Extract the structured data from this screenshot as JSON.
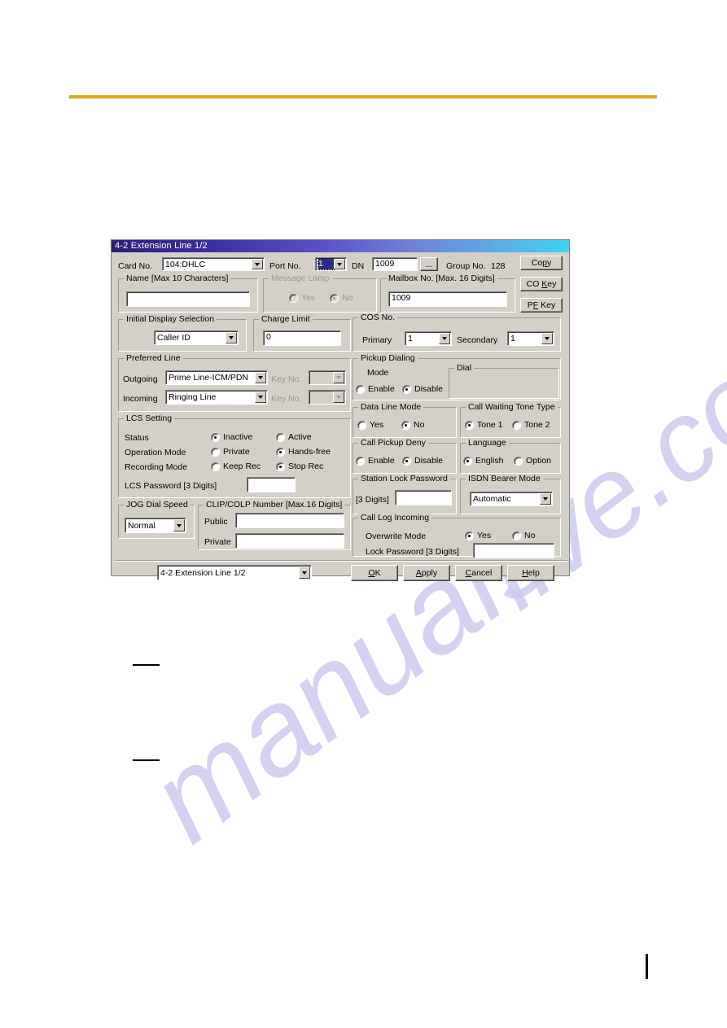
{
  "page": {
    "watermark_left": "manuals",
    "watermark_right": "live.com"
  },
  "dialog": {
    "title": "4-2 Extension Line 1/2",
    "header": {
      "card_no_label": "Card No.",
      "card_no_value": "104:DHLC",
      "port_no_label": "Port No.",
      "port_no_value": "1",
      "dn_label": "DN",
      "dn_value": "1009",
      "dn_browse_label": "...",
      "group_no_label": "Group No.",
      "group_no_value": "128"
    },
    "side_buttons": [
      {
        "name": "copy-button",
        "pre": "Co",
        "key": "p",
        "post": "y"
      },
      {
        "name": "co-key-button",
        "pre": "CO ",
        "key": "K",
        "post": "ey"
      },
      {
        "name": "pf-key-button",
        "pre": "P",
        "key": "F",
        "post": " Key"
      }
    ],
    "name_group": {
      "legend": "Name [Max 10 Characters]",
      "value": ""
    },
    "message_lamp_group": {
      "legend": "Message Lamp",
      "options": [
        "Yes",
        "No"
      ],
      "selected": "No",
      "disabled": true
    },
    "mailbox_group": {
      "legend": "Mailbox No. [Max. 16 Digits]",
      "value": "1009"
    },
    "initial_display_group": {
      "legend": "Initial Display Selection",
      "value": "Caller ID"
    },
    "charge_limit_group": {
      "legend": "Charge Limit",
      "value": "0"
    },
    "cos_group": {
      "legend": "COS No.",
      "primary_label": "Primary",
      "primary_value": "1",
      "secondary_label": "Secondary",
      "secondary_value": "1"
    },
    "preferred_line_group": {
      "legend": "Preferred Line",
      "outgoing_label": "Outgoing",
      "outgoing_value": "Prime Line-ICM/PDN",
      "outgoing_key_label": "Key No.",
      "outgoing_key_value": "",
      "incoming_label": "Incoming",
      "incoming_value": "Ringing Line",
      "incoming_key_label": "Key No.",
      "incoming_key_value": ""
    },
    "pickup_dialing_group": {
      "legend": "Pickup Dialing",
      "mode_label": "Mode",
      "options": [
        "Enable",
        "Disable"
      ],
      "selected": "Disable",
      "dial_legend": "Dial"
    },
    "data_line_group": {
      "legend": "Data Line Mode",
      "options": [
        "Yes",
        "No"
      ],
      "selected": "No"
    },
    "call_waiting_group": {
      "legend": "Call Waiting Tone Type",
      "options": [
        "Tone 1",
        "Tone 2"
      ],
      "selected": "Tone 1"
    },
    "lcs_group": {
      "legend": "LCS Setting",
      "status_label": "Status",
      "status_options": [
        "Inactive",
        "Active"
      ],
      "status_selected": "Inactive",
      "operation_label": "Operation Mode",
      "operation_options": [
        "Private",
        "Hands-free"
      ],
      "operation_selected": "Hands-free",
      "recording_label": "Recording Mode",
      "recording_options": [
        "Keep Rec",
        "Stop Rec"
      ],
      "recording_selected": "Stop Rec",
      "password_label": "LCS Password [3 Digits]",
      "password_value": ""
    },
    "call_pickup_deny_group": {
      "legend": "Call Pickup Deny",
      "options": [
        "Enable",
        "Disable"
      ],
      "selected": "Disable"
    },
    "language_group": {
      "legend": "Language",
      "options": [
        "English",
        "Option"
      ],
      "selected": "English"
    },
    "station_lock_group": {
      "legend": "Station Lock Password",
      "digits_label": "[3 Digits]",
      "value": ""
    },
    "isdn_group": {
      "legend": "ISDN Bearer Mode",
      "value": "Automatic"
    },
    "jog_group": {
      "legend": "JOG Dial Speed",
      "value": "Normal"
    },
    "clip_colp_group": {
      "legend": "CLIP/COLP Number [Max.16 Digits]",
      "public_label": "Public",
      "public_value": "",
      "private_label": "Private",
      "private_value": ""
    },
    "call_log_group": {
      "legend": "Call Log Incoming",
      "overwrite_label": "Overwrite Mode",
      "overwrite_options": [
        "Yes",
        "No"
      ],
      "overwrite_selected": "Yes",
      "lock_password_label": "Lock Password [3 Digits]",
      "lock_password_value": ""
    },
    "footer": {
      "screen_select_value": "4-2 Extension Line 1/2",
      "buttons": [
        {
          "name": "ok-button",
          "pre": "",
          "key": "O",
          "post": "K"
        },
        {
          "name": "apply-button",
          "pre": "",
          "key": "A",
          "post": "pply"
        },
        {
          "name": "cancel-button",
          "pre": "",
          "key": "C",
          "post": "ancel"
        },
        {
          "name": "help-button",
          "pre": "",
          "key": "H",
          "post": "elp"
        }
      ]
    }
  }
}
